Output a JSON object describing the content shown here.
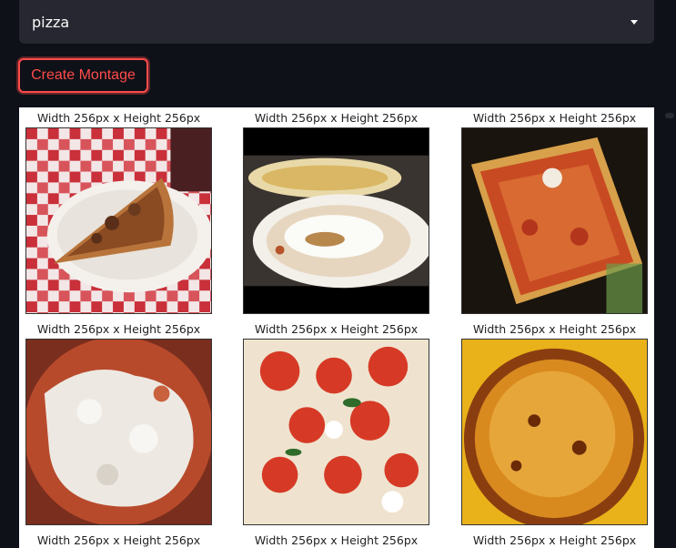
{
  "select": {
    "value": "pizza",
    "icon": "caret-down-icon"
  },
  "create_button": {
    "label": "Create Montage",
    "color": "#ff4b4b"
  },
  "montage": {
    "captions": [
      "Width 256px x Height 256px",
      "Width 256px x Height 256px",
      "Width 256px x Height 256px",
      "Width 256px x Height 256px",
      "Width 256px x Height 256px",
      "Width 256px x Height 256px",
      "Width 256px x Height 256px",
      "Width 256px x Height 256px",
      "Width 256px x Height 256px"
    ]
  },
  "colors": {
    "background": "#0e1117",
    "select_bg": "#262730",
    "accent": "#ff4b4b"
  }
}
